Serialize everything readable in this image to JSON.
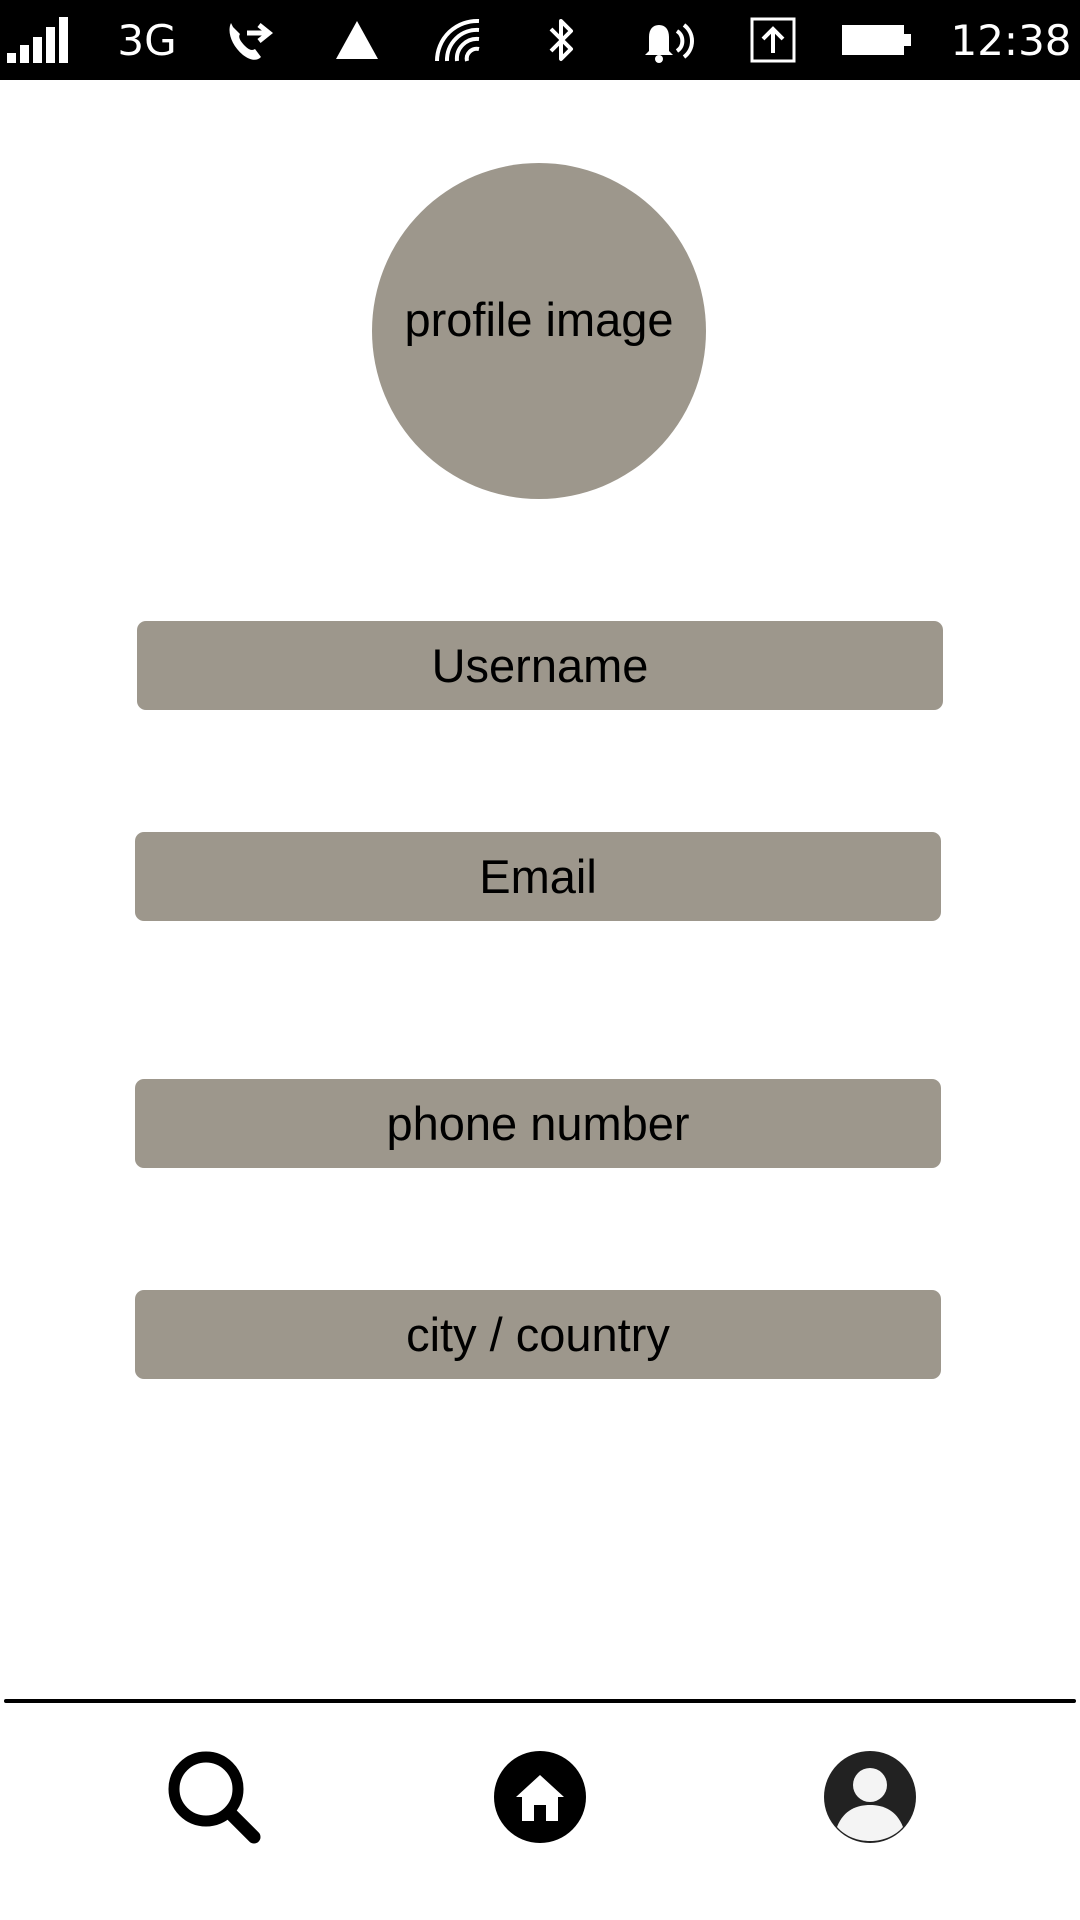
{
  "status_bar": {
    "network_type": "3G",
    "time": "12:38",
    "icons": [
      "signal-strength-icon",
      "call-forwarding-icon",
      "alert-triangle-icon",
      "wifi-icon",
      "bluetooth-icon",
      "ringer-volume-icon",
      "upload-icon",
      "battery-icon"
    ]
  },
  "profile": {
    "image_label": "profile image"
  },
  "form": {
    "username_label": "Username",
    "email_label": "Email",
    "phone_label": "phone number",
    "location_label": "city / country"
  },
  "bottom_nav": {
    "items": [
      "search-icon",
      "home-icon",
      "profile-icon"
    ]
  },
  "colors": {
    "placeholder_fill": "#9d978c",
    "status_bar_bg": "#000000",
    "background": "#ffffff"
  }
}
